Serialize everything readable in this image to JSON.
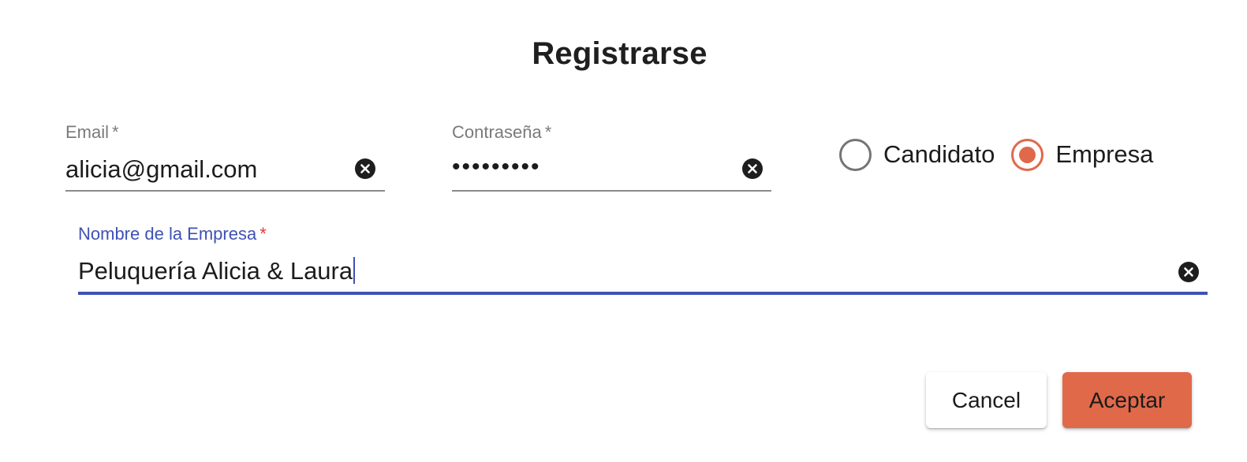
{
  "dialog": {
    "title": "Registrarse"
  },
  "form": {
    "email": {
      "label": "Email",
      "required_mark": "*",
      "value": "alicia@gmail.com"
    },
    "password": {
      "label": "Contraseña",
      "required_mark": "*",
      "value": "•••••••••"
    },
    "account_type": {
      "options": [
        {
          "label": "Candidato",
          "selected": false
        },
        {
          "label": "Empresa",
          "selected": true
        }
      ]
    },
    "company_name": {
      "label": "Nombre de la Empresa",
      "required_mark": "*",
      "value": "Peluquería Alicia & Laura",
      "focused": true
    }
  },
  "actions": {
    "cancel_label": "Cancel",
    "accept_label": "Aceptar"
  },
  "colors": {
    "accent": "#e0694a",
    "focus": "#3f51b5",
    "required_focused": "#e53935",
    "label": "#7a7a7a",
    "text": "#1c1c1c"
  },
  "icons": {
    "clear": "close-circle-icon",
    "radio_unchecked": "radio-unchecked-icon",
    "radio_checked": "radio-checked-icon"
  }
}
